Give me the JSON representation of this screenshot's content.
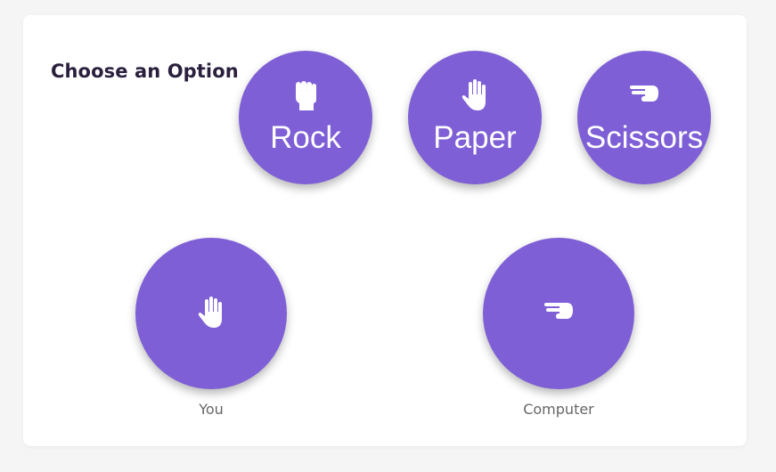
{
  "game": {
    "heading": "Choose an Option",
    "accent_color": "#7e5fd6",
    "options": [
      {
        "label": "Rock",
        "icon": "fist-icon"
      },
      {
        "label": "Paper",
        "icon": "raised-hand-icon"
      },
      {
        "label": "Scissors",
        "icon": "pointing-hand-icon"
      }
    ],
    "player": {
      "label": "You",
      "choice_icon": "raised-hand-icon"
    },
    "computer": {
      "label": "Computer",
      "choice_icon": "pointing-hand-icon"
    }
  }
}
